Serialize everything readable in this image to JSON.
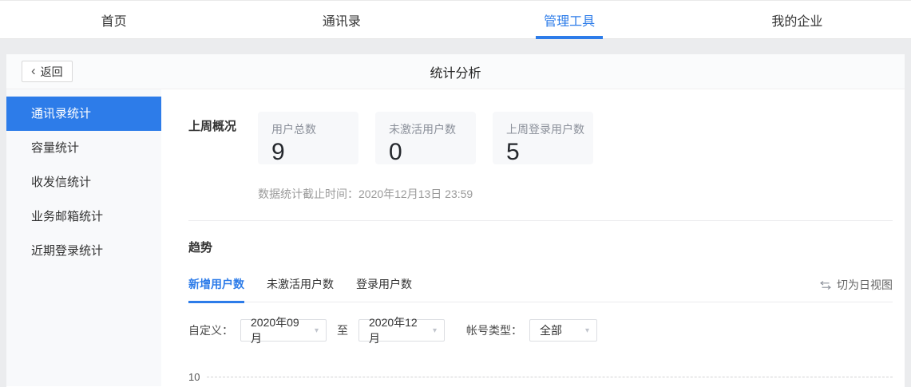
{
  "nav": {
    "items": [
      {
        "label": "首页",
        "active": false
      },
      {
        "label": "通讯录",
        "active": false
      },
      {
        "label": "管理工具",
        "active": true
      },
      {
        "label": "我的企业",
        "active": false
      }
    ]
  },
  "header": {
    "back_label": "返回",
    "title": "统计分析"
  },
  "sidebar": {
    "items": [
      {
        "label": "通讯录统计",
        "active": true
      },
      {
        "label": "容量统计",
        "active": false
      },
      {
        "label": "收发信统计",
        "active": false
      },
      {
        "label": "业务邮箱统计",
        "active": false
      },
      {
        "label": "近期登录统计",
        "active": false
      }
    ]
  },
  "overview": {
    "section_title": "上周概况",
    "cards": [
      {
        "label": "用户总数",
        "value": "9"
      },
      {
        "label": "未激活用户数",
        "value": "0"
      },
      {
        "label": "上周登录用户数",
        "value": "5"
      }
    ],
    "cutoff_text": "数据统计截止时间：2020年12月13日 23:59"
  },
  "trend": {
    "section_title": "趋势",
    "tabs": [
      {
        "label": "新增用户数",
        "active": true
      },
      {
        "label": "未激活用户数",
        "active": false
      },
      {
        "label": "登录用户数",
        "active": false
      }
    ],
    "switch_view_label": "切为日视图",
    "filters": {
      "custom_label": "自定义：",
      "start_month": "2020年09月",
      "to_label": "至",
      "end_month": "2020年12月",
      "account_type_label": "帐号类型：",
      "account_type_value": "全部"
    }
  },
  "chart_data": {
    "type": "line",
    "title": "新增用户数",
    "x_range": [
      "2020年09月",
      "2020年12月"
    ],
    "visible_y_ticks": [
      10
    ],
    "ylabel": "",
    "grid": "dashed-horizontal",
    "note_visible_portion": "only the y=10 dashed gridline is visible in the screenshot"
  },
  "icons": {
    "back_chevron": "‹",
    "dropdown_caret": "▾"
  },
  "colors": {
    "accent_blue": "#2d7ce9",
    "card_bg": "#f7f8fa",
    "page_bg": "#ebecee"
  }
}
